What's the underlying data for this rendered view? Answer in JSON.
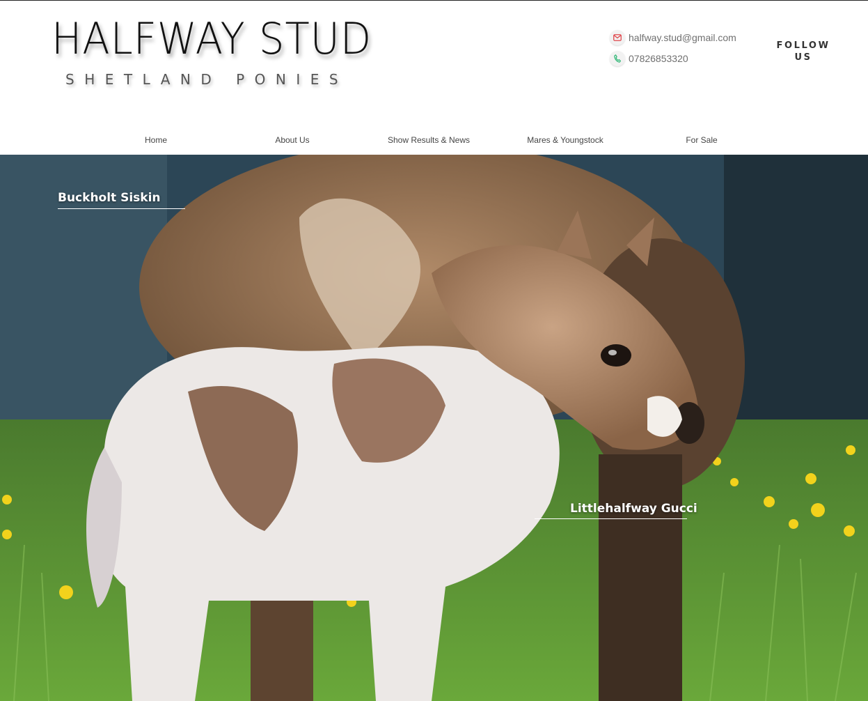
{
  "site": {
    "title": "HALFWAY STUD",
    "subtitle": "SHETLAND PONIES"
  },
  "contact": {
    "email": "halfway.stud@gmail.com",
    "phone": "07826853320",
    "email_icon": "envelope-icon",
    "phone_icon": "phone-icon"
  },
  "follow": {
    "line1": "FOLLOW",
    "line2": "US"
  },
  "nav": {
    "items": [
      {
        "label": "Home"
      },
      {
        "label": "About Us"
      },
      {
        "label": "Show Results & News"
      },
      {
        "label": "Mares & Youngstock"
      },
      {
        "label": "For Sale"
      }
    ]
  },
  "hero": {
    "caption_top": "Buckholt Siskin",
    "caption_bottom": "Littlehalfway Gucci"
  },
  "colors": {
    "email_icon": "#e0474c",
    "phone_icon": "#2bb673",
    "text": "#444444"
  }
}
